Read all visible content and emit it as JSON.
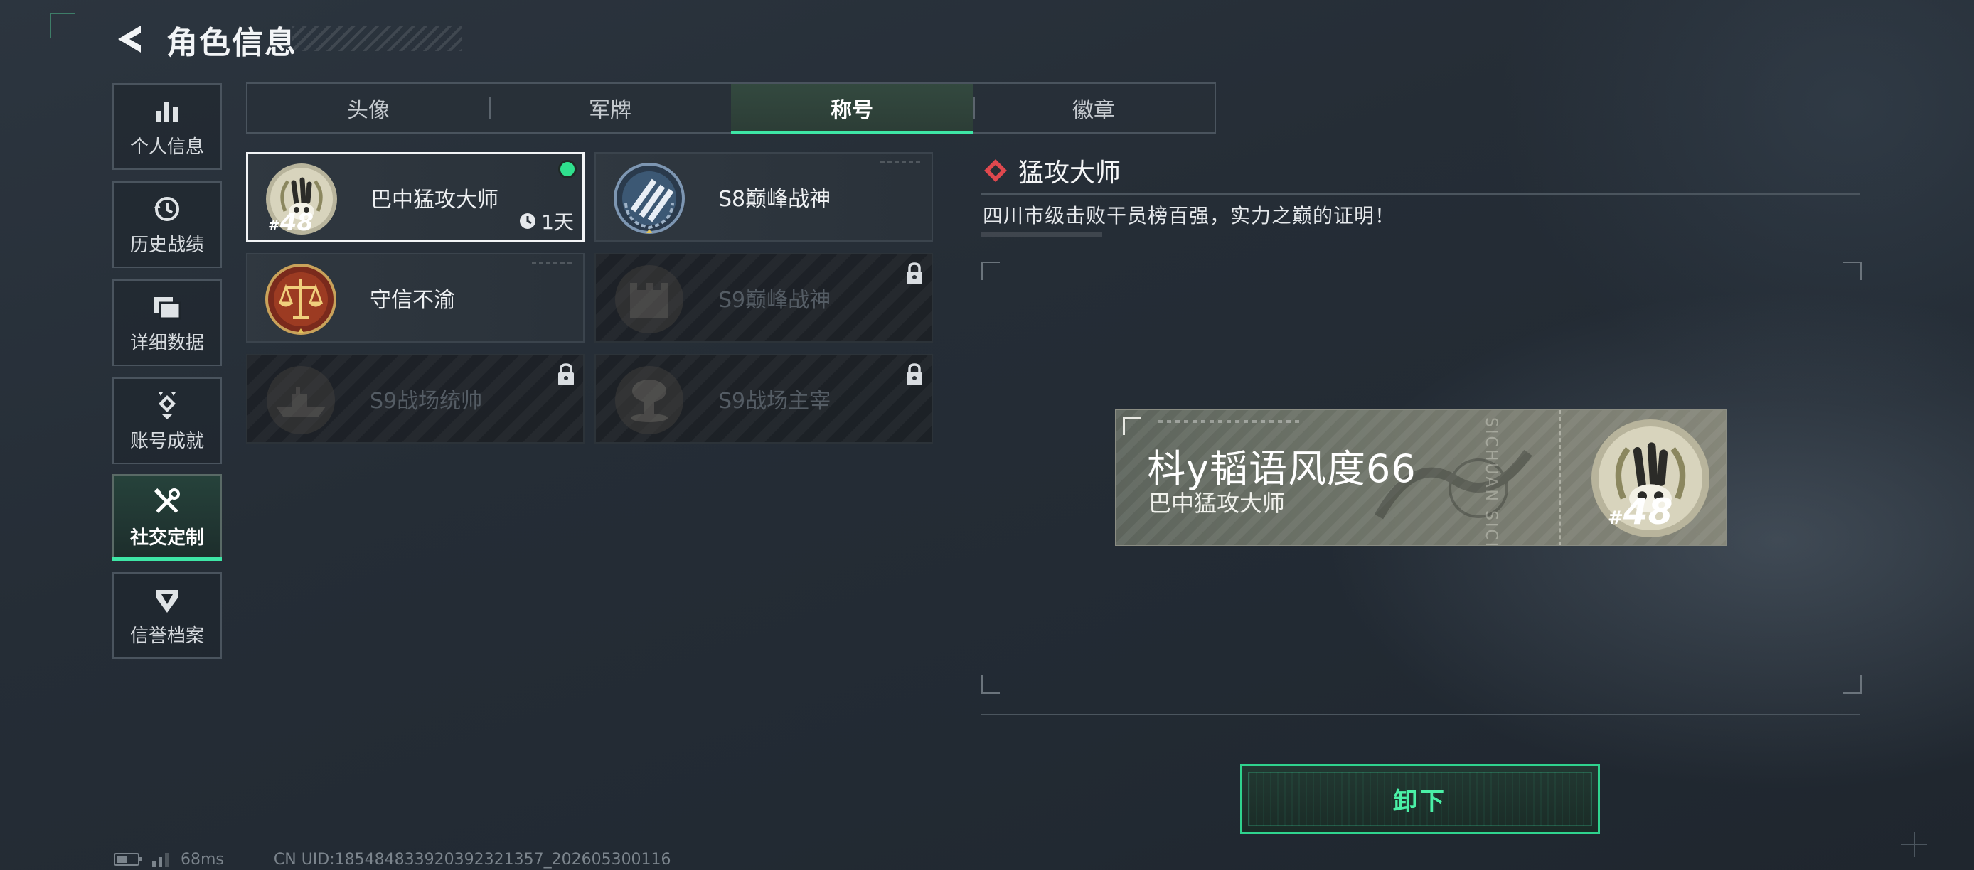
{
  "header": {
    "title": "角色信息"
  },
  "nav": [
    {
      "label": "个人信息",
      "icon": "bar-chart-icon"
    },
    {
      "label": "历史战绩",
      "icon": "history-clock-icon"
    },
    {
      "label": "详细数据",
      "icon": "folders-icon"
    },
    {
      "label": "账号成就",
      "icon": "achievement-icon"
    },
    {
      "label": "社交定制",
      "icon": "tools-icon",
      "active": true
    },
    {
      "label": "信誉档案",
      "icon": "credit-shield-icon"
    }
  ],
  "tabs": [
    {
      "label": "头像"
    },
    {
      "label": "军牌"
    },
    {
      "label": "称号",
      "active": true
    },
    {
      "label": "徽章"
    }
  ],
  "titles": [
    {
      "name": "巴中猛攻大师",
      "level": "48",
      "timer": "1天",
      "equipped": true,
      "selected": true,
      "locked": false
    },
    {
      "name": "S8巅峰战神",
      "locked": false
    },
    {
      "name": "守信不渝",
      "locked": false
    },
    {
      "name": "S9巅峰战神",
      "locked": true
    },
    {
      "name": "S9战场统帅",
      "locked": true
    },
    {
      "name": "S9战场主宰",
      "locked": true
    }
  ],
  "detail": {
    "title": "猛攻大师",
    "description": "四川市级击败干员榜百强，实力之巅的证明！"
  },
  "nameplate": {
    "player_name": "枓y韬语风度66",
    "title": "巴中猛攻大师",
    "level": "48",
    "vertical_text": "SICHUAN SICHUAN"
  },
  "actions": {
    "unequip_label": "卸下"
  },
  "status": {
    "ping": "68ms",
    "uid": "CN UID:18548483392039232135​7_202605300116"
  },
  "colors": {
    "accent": "#3ee6a6",
    "equipped": "#2fe08d",
    "diamond": "#e0484e"
  }
}
